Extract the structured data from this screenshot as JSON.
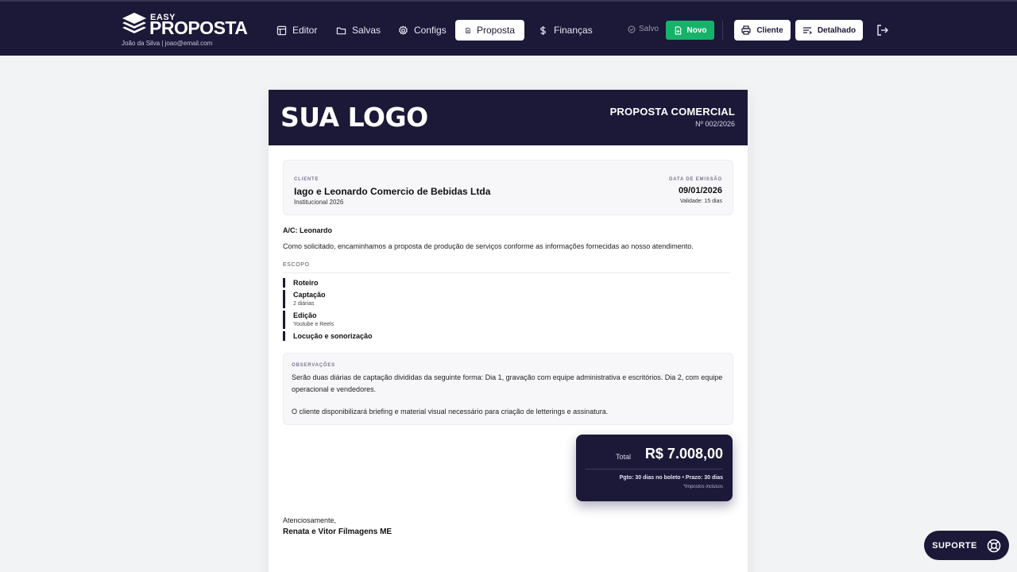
{
  "brand": {
    "easy": "EASY",
    "name": "PROPOSTA",
    "user": "João da Silva | joao@email.com"
  },
  "nav": {
    "items": [
      {
        "label": "Editor",
        "icon": "layout-icon"
      },
      {
        "label": "Salvas",
        "icon": "folder-icon"
      },
      {
        "label": "Configs",
        "icon": "gear-icon"
      },
      {
        "label": "Proposta",
        "icon": "document-icon",
        "active": true
      },
      {
        "label": "Finanças",
        "icon": "dollar-icon"
      }
    ]
  },
  "toolbar": {
    "saved": "Salvo",
    "new": "Novo",
    "client": "Cliente",
    "detailed": "Detalhado"
  },
  "colors": {
    "navy": "#1c1838",
    "green": "#17b26a",
    "background": "#f2f3f5"
  },
  "document": {
    "logo": "SUA LOGO",
    "title": "PROPOSTA COMERCIAL",
    "number": "Nº 002/2026",
    "client": {
      "label": "CLIENTE",
      "name": "Iago e Leonardo Comercio de Bebidas Ltda",
      "project": "Institucional 2026",
      "date_label": "DATA DE EMISSÃO",
      "date": "09/01/2026",
      "validity": "Validade: 15 dias"
    },
    "attention": "A/C: Leonardo",
    "intro": "Como solicitado, encaminhamos a proposta de produção de serviços conforme as informações fornecidas ao nosso atendimento.",
    "scope_title": "ESCOPO",
    "scope": [
      {
        "name": "Roteiro",
        "detail": ""
      },
      {
        "name": "Captação",
        "detail": "2 diárias"
      },
      {
        "name": "Edição",
        "detail": "Youtube e Reels"
      },
      {
        "name": "Locução e sonorização",
        "detail": ""
      }
    ],
    "observations": {
      "label": "OBSERVAÇÕES",
      "paragraph1": "Serão duas diárias de captação divididas da seguinte forma: Dia 1, gravação com equipe administrativa e escritórios. Dia 2, com equipe operacional e vendedores.",
      "paragraph2": "O cliente disponibilizará briefing e material visual necessário para criação de letterings e assinatura."
    },
    "total": {
      "label": "Total",
      "value": "R$ 7.008,00",
      "terms": "Pgto: 30 dias no boleto • Prazo: 30 dias",
      "taxes": "*Impostos inclusos"
    },
    "regards": "Atenciosamente,",
    "signature": "Renata e Vitor Filmagens ME"
  },
  "support": {
    "label": "SUPORTE"
  }
}
